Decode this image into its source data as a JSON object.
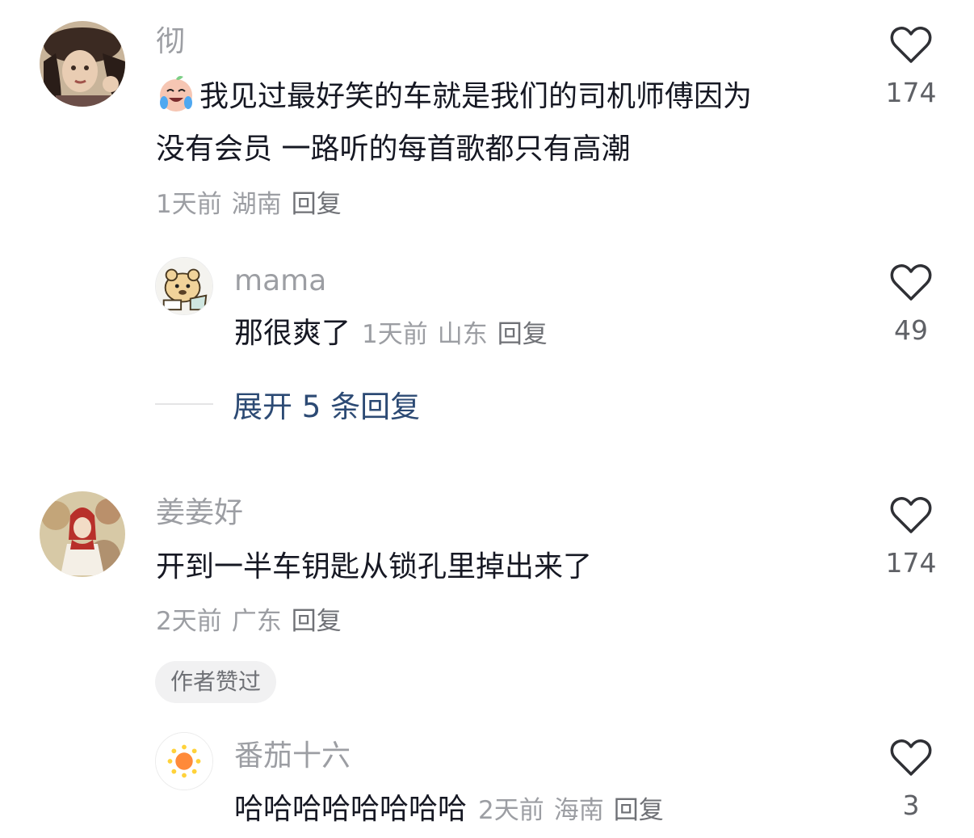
{
  "comments": [
    {
      "username": "彻",
      "emoji": "crying-laughing-emoji",
      "text_line1": "我见过最好笑的车就是我们的司机师傅因为",
      "text_line2": "没有会员 一路听的每首歌都只有高潮",
      "time": "1天前",
      "location": "湖南",
      "reply_label": "回复",
      "likes": "174",
      "replies": [
        {
          "username": "mama",
          "text": "那很爽了",
          "time": "1天前",
          "location": "山东",
          "reply_label": "回复",
          "likes": "49"
        }
      ],
      "expand_label": "展开 5 条回复"
    },
    {
      "username": "姜姜好",
      "text": "开到一半车钥匙从锁孔里掉出来了",
      "time": "2天前",
      "location": "广东",
      "reply_label": "回复",
      "likes": "174",
      "badge": "作者赞过",
      "replies": [
        {
          "username": "番茄十六",
          "text": "哈哈哈哈哈哈哈哈",
          "time": "2天前",
          "location": "海南",
          "reply_label": "回复",
          "likes": "3"
        }
      ]
    }
  ],
  "colors": {
    "text": "#161823",
    "secondary": "#9c9ea3",
    "link": "#2c4a74",
    "badge_bg": "#f1f1f2"
  }
}
